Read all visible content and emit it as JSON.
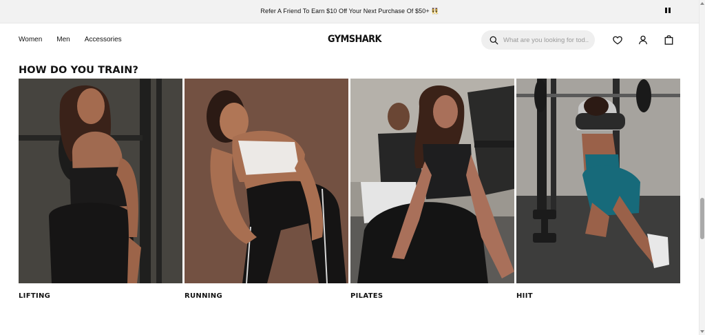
{
  "announcement": {
    "text": "Refer A Friend To Earn $10 Off Your Next Purchase Of $50+ 👯"
  },
  "header": {
    "nav": [
      {
        "label": "Women"
      },
      {
        "label": "Men"
      },
      {
        "label": "Accessories"
      }
    ],
    "logo": "GYMSHARK",
    "search": {
      "placeholder": "What are you looking for tod..."
    },
    "icons": [
      "heart-icon",
      "account-icon",
      "bag-icon"
    ]
  },
  "section": {
    "title": "HOW DO YOU TRAIN?",
    "cards": [
      {
        "label": "LIFTING"
      },
      {
        "label": "RUNNING"
      },
      {
        "label": "PILATES"
      },
      {
        "label": "HIIT"
      }
    ]
  },
  "colors": {
    "announcement_bg": "#f2f2f2",
    "search_bg": "#efefef",
    "text": "#111111"
  }
}
